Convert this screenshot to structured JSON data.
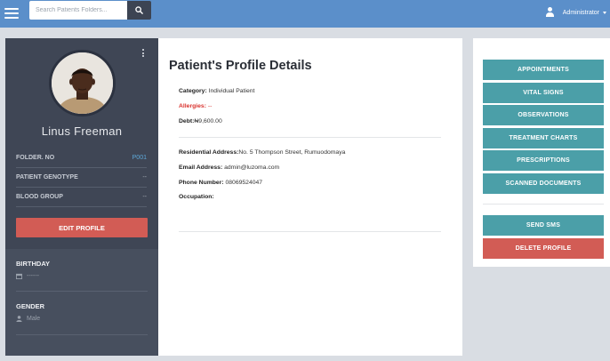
{
  "topbar": {
    "search_placeholder": "Search Patients Folders...",
    "user_name": "Administrator"
  },
  "profile": {
    "name": "Linus Freeman",
    "rows": [
      {
        "label": "FOLDER. NO",
        "value": "P001"
      },
      {
        "label": "PATIENT GENOTYPE",
        "value": "--"
      },
      {
        "label": "BLOOD GROUP",
        "value": "--"
      }
    ],
    "edit_label": "EDIT PROFILE",
    "birthday": {
      "title": "BIRTHDAY",
      "value": "------"
    },
    "gender": {
      "title": "GENDER",
      "value": "Male"
    }
  },
  "details": {
    "title": "Patient's Profile Details",
    "category": {
      "label": "Category:",
      "value": " Individual Patient"
    },
    "allergies": {
      "label": "Allergies:",
      "value": " --"
    },
    "debt": {
      "label": "Debt:",
      "value": "₦9,600.00"
    },
    "address": {
      "label": "Residential Address:",
      "value": "No. 5 Thompson Street, Rumuodomaya"
    },
    "email": {
      "label": "Email Address:",
      "value": " admin@luzoma.com"
    },
    "phone": {
      "label": "Phone Number:",
      "value": " 08069524047"
    },
    "occupation": {
      "label": "Occupation:",
      "value": ""
    }
  },
  "actions": {
    "appointments": "APPOINTMENTS",
    "vital_signs": "VITAL SIGNS",
    "observations": "OBSERVATIONS",
    "treatment_charts": "TREATMENT CHARTS",
    "prescriptions": "PRESCRIPTIONS",
    "scanned_documents": "SCANNED DOCUMENTS",
    "send_sms": "SEND SMS",
    "delete_profile": "DELETE PROFILE"
  },
  "colors": {
    "topbar": "#5b8fca",
    "teal_button": "#4b9fa8",
    "red_button": "#d25c55",
    "sidebar": "#474f5e"
  }
}
